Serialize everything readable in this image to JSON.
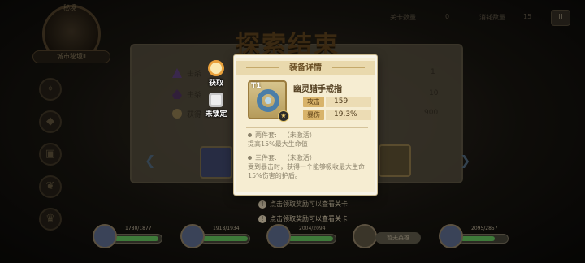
{
  "top_bar": {
    "stat1_label": "关卡数量",
    "stat1_value": "0",
    "stat2_label": "消耗数量",
    "stat2_value": "15",
    "pause_label": "II"
  },
  "portal": {
    "top_label": "秘境",
    "name_label": "城市秘境Ⅱ"
  },
  "background": {
    "title": "探索结束",
    "rows": [
      {
        "label": "击杀",
        "value": "1"
      },
      {
        "label": "击杀",
        "value": "10"
      },
      {
        "label": "获得",
        "value": "900"
      }
    ],
    "hint1": "点击领取奖励可以查看关卡",
    "hint2": "点击领取奖励可以查看关卡"
  },
  "badges": {
    "collect_label": "获取",
    "unlock_label": "未锁定"
  },
  "popup": {
    "header": "装备详情",
    "item": {
      "tier": "T1",
      "name": "幽灵猎手戒指",
      "star": "★"
    },
    "attributes": [
      {
        "key": "攻击",
        "value": "159"
      },
      {
        "key": "暴伤",
        "value": "19.3%"
      }
    ],
    "set_two": {
      "title": "两件套:",
      "status": "（未激活）",
      "desc": "提高15%最大生命值"
    },
    "set_three": {
      "title": "三件套:",
      "status": "（未激活）",
      "desc": "受到暴击时，获得一个能够吸收最大生命15%伤害的护盾。"
    }
  },
  "team": [
    {
      "hp": "1780/1877"
    },
    {
      "hp": "1918/1934"
    },
    {
      "hp": "2004/2094"
    },
    {
      "tag": "暂无英雄"
    },
    {
      "hp": "2095/2857"
    }
  ],
  "colors": {
    "popup_bg": "#f6edd2",
    "attr_key_bg": "#d8b36a",
    "title_brown": "#6b4c22"
  }
}
